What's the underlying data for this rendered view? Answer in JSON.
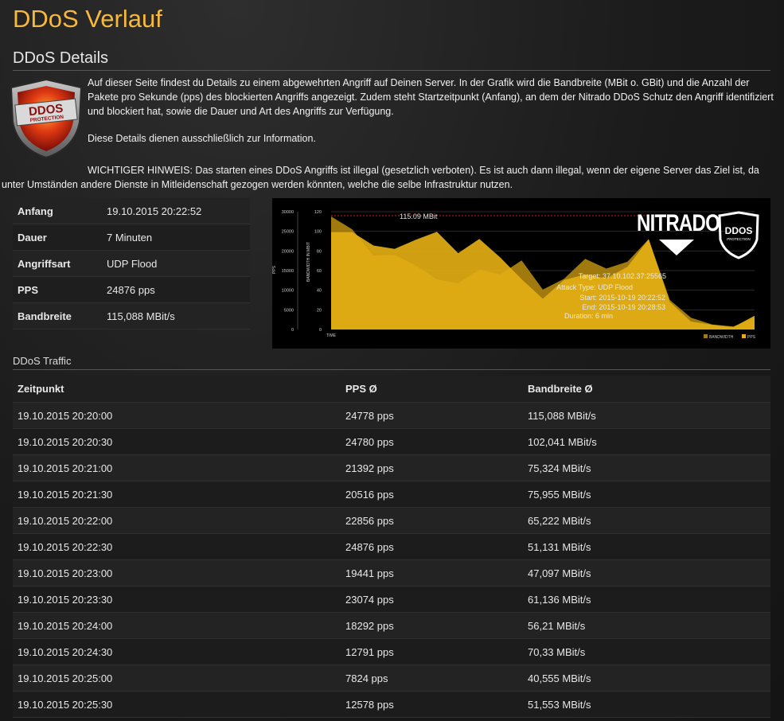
{
  "page": {
    "title": "DDoS Verlauf",
    "section_title": "DDoS Details",
    "traffic_title": "DDoS Traffic"
  },
  "intro": {
    "p1": "Auf dieser Seite findest du Details zu einem abgewehrten Angriff auf Deinen Server. In der Grafik wird die Bandbreite (MBit o. GBit) und die Anzahl der Pakete pro Sekunde (pps) des blockierten Angriffs angezeigt. Zudem steht Startzeitpunkt (Anfang), an dem der Nitrado DDoS Schutz den Angriff identifiziert und blockiert hat, sowie die Dauer und Art des Angriffs zur Verfügung.",
    "p2": "Diese Details dienen ausschließlich zur Information.",
    "warning": "WICHTIGER HINWEIS: Das starten eines DDoS Angriffs ist illegal (gesetzlich verboten). Es ist auch dann illegal, wenn der eigene Server das Ziel ist, da unter Umständen andere Dienste in Mitleidenschaft gezogen werden könnten, welche die selbe Infrastruktur nutzen."
  },
  "shield": {
    "line1": "DDOS",
    "line2": "PROTECTION"
  },
  "details": [
    {
      "label": "Anfang",
      "value": "19.10.2015 20:22:52"
    },
    {
      "label": "Dauer",
      "value": "7 Minuten"
    },
    {
      "label": "Angriffsart",
      "value": "UDP Flood"
    },
    {
      "label": "PPS",
      "value": "24876 pps"
    },
    {
      "label": "Bandbreite",
      "value": "115,088 MBit/s"
    }
  ],
  "chart_data": {
    "type": "area",
    "peak_label": "115.09 MBit",
    "brand": "NITRADO",
    "badge_line1": "DDOS",
    "badge_line2": "PROTECTION",
    "ylabel_left": "PPS",
    "ylabel_right": "BANDWIDTH IN MBIT",
    "xlabel": "TIME",
    "pps_ticks": [
      "30000",
      "25000",
      "20000",
      "15000",
      "10000",
      "5000",
      "0"
    ],
    "bw_ticks": [
      "120",
      "100",
      "80",
      "60",
      "40",
      "20",
      "0"
    ],
    "pps_max": 30000,
    "bw_max": 120,
    "info": [
      "Target: 37.10.102.37:25565",
      "Attack Type: UDP Flood",
      "Start: 2015-10-19 20:22:52",
      "End: 2015-10-19 20:28:53",
      "Duration: 6 min"
    ],
    "legend": [
      "BANDWIDTH",
      "PPS"
    ],
    "series": [
      {
        "name": "BANDWIDTH",
        "color": "#a07a0e",
        "values": [
          115.1,
          102,
          75.3,
          76,
          65.2,
          51.1,
          47.1,
          61.1,
          56.2,
          70.3,
          40.6,
          51.6,
          72,
          62,
          69,
          92,
          30,
          12,
          5,
          3,
          12
        ]
      },
      {
        "name": "PPS",
        "color": "#e2ae14",
        "values": [
          24778,
          24780,
          21392,
          20516,
          22856,
          24876,
          19441,
          23074,
          18292,
          12791,
          7824,
          12578,
          14000,
          13000,
          16000,
          23000,
          7000,
          2000,
          1200,
          600,
          3500
        ]
      }
    ]
  },
  "traffic": {
    "headers": [
      "Zeitpunkt",
      "PPS Ø",
      "Bandbreite Ø"
    ],
    "rows": [
      [
        "19.10.2015 20:20:00",
        "24778 pps",
        "115,088 MBit/s"
      ],
      [
        "19.10.2015 20:20:30",
        "24780 pps",
        "102,041 MBit/s"
      ],
      [
        "19.10.2015 20:21:00",
        "21392 pps",
        "75,324 MBit/s"
      ],
      [
        "19.10.2015 20:21:30",
        "20516 pps",
        "75,955 MBit/s"
      ],
      [
        "19.10.2015 20:22:00",
        "22856 pps",
        "65,222 MBit/s"
      ],
      [
        "19.10.2015 20:22:30",
        "24876 pps",
        "51,131 MBit/s"
      ],
      [
        "19.10.2015 20:23:00",
        "19441 pps",
        "47,097 MBit/s"
      ],
      [
        "19.10.2015 20:23:30",
        "23074 pps",
        "61,136 MBit/s"
      ],
      [
        "19.10.2015 20:24:00",
        "18292 pps",
        "56,21 MBit/s"
      ],
      [
        "19.10.2015 20:24:30",
        "12791 pps",
        "70,33 MBit/s"
      ],
      [
        "19.10.2015 20:25:00",
        "7824 pps",
        "40,555 MBit/s"
      ],
      [
        "19.10.2015 20:25:30",
        "12578 pps",
        "51,553 MBit/s"
      ]
    ]
  }
}
